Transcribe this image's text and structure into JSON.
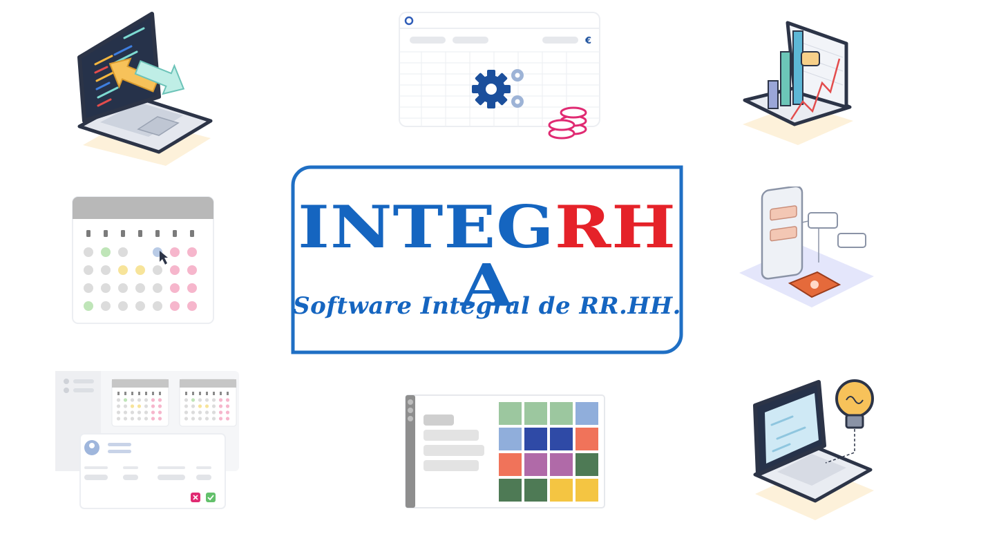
{
  "brand": {
    "part_blue": "INTEG",
    "part_red": "RH",
    "part_blue_end": "A",
    "tagline": "Software Integral de RR.HH."
  },
  "spreadsheet": {
    "currency_symbol": "€"
  },
  "colors": {
    "brand_blue": "#1565c0",
    "brand_red": "#e52229",
    "frame_blue": "#1f6fc4",
    "navy": "#1b4f9c",
    "pink": "#e02a72",
    "green": "#63c06b"
  },
  "icons": [
    "laptop-code-icon",
    "spreadsheet-gears-icon",
    "bar-chart-laptop-icon",
    "calendar-icon",
    "mobile-app-icon",
    "leave-request-icon",
    "heatmap-panel-icon",
    "laptop-lightbulb-icon"
  ]
}
